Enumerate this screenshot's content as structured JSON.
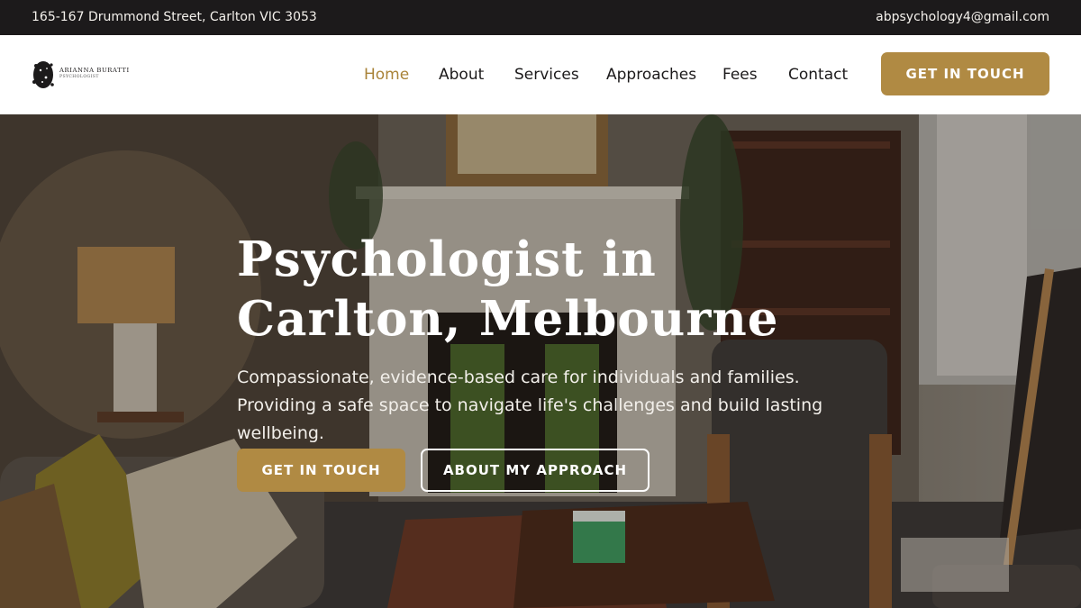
{
  "topbar": {
    "address": "165-167 Drummond Street, Carlton VIC 3053",
    "email": "abpsychology4@gmail.com"
  },
  "logo": {
    "name": "ARIANNA BURATTI",
    "subtitle": "PSYCHOLOGIST"
  },
  "nav": {
    "items": [
      {
        "label": "Home",
        "active": true
      },
      {
        "label": "About",
        "active": false
      },
      {
        "label": "Services",
        "active": false
      },
      {
        "label": "Approaches",
        "active": false
      },
      {
        "label": "Fees",
        "active": false
      },
      {
        "label": "Contact",
        "active": false
      }
    ],
    "cta_label": "GET IN TOUCH"
  },
  "hero": {
    "title": "Psychologist in Carlton, Melbourne",
    "text": "Compassionate, evidence-based care for individuals and families. Providing a safe space to navigate life's challenges and build lasting wellbeing.",
    "primary_button": "GET IN TOUCH",
    "secondary_button": "ABOUT MY APPROACH"
  },
  "colors": {
    "accent": "#b08a43",
    "topbar_bg": "#1c1a1b",
    "active_nav": "#a98339"
  }
}
